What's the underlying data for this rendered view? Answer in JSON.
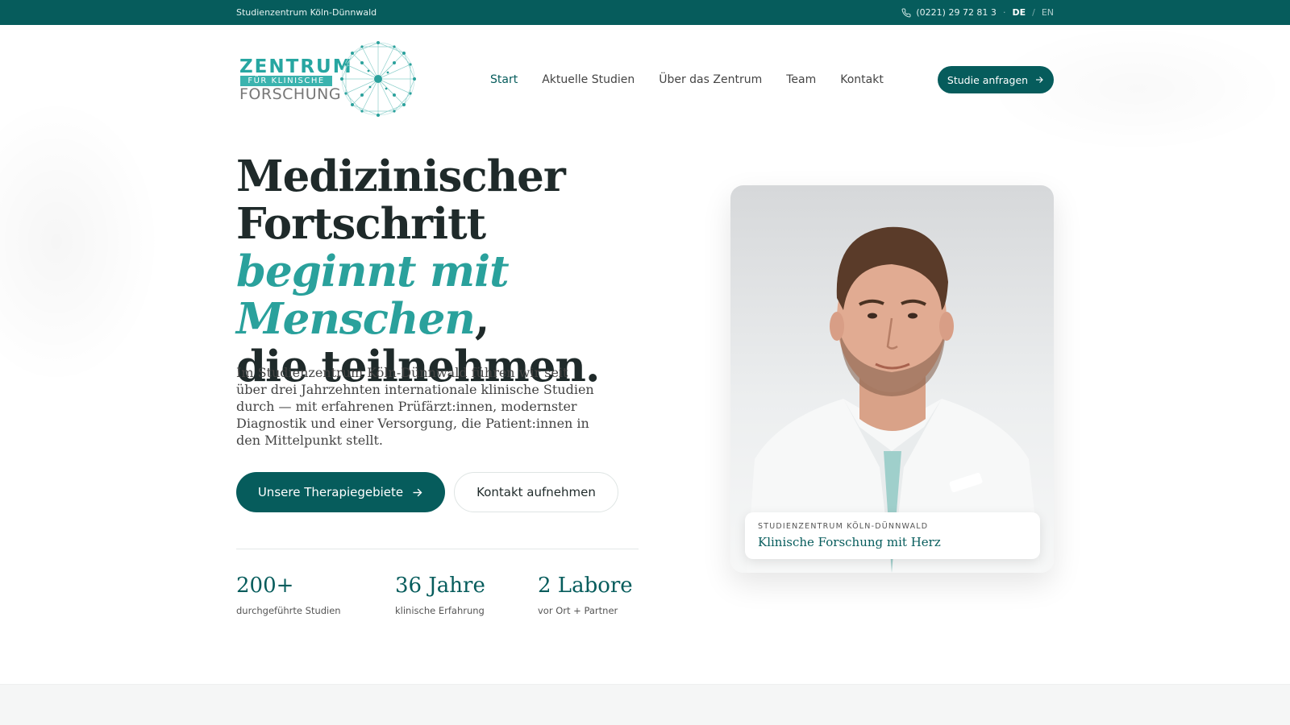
{
  "topbar": {
    "site_name": "Studienzentrum Köln-Dünnwald",
    "phone": "(0221) 29 72 81 3",
    "separator": "·",
    "lang_active": "DE",
    "lang_sep": "/",
    "lang_other": "EN"
  },
  "logo": {
    "line1": "ZENTRUM",
    "line2": "FÜR KLINISCHE",
    "line3": "FORSCHUNG"
  },
  "nav": {
    "items": [
      {
        "label": "Start",
        "active": true
      },
      {
        "label": "Aktuelle Studien"
      },
      {
        "label": "Über das Zentrum"
      },
      {
        "label": "Team"
      },
      {
        "label": "Kontakt"
      }
    ],
    "cta_label": "Studie anfragen",
    "cta_icon": "arrow-right-icon"
  },
  "hero": {
    "headline_part1": "Medizinischer Fortschritt ",
    "headline_accent": "beginnt mit Menschen",
    "headline_part2": ",",
    "headline_part3": "die teilnehmen.",
    "lede": "Im Studienzentrum Köln-Dünnwald führen wir seit über drei Jahrzehnten internationale klinische Studien durch — mit erfahrenen Prüfärzt:innen, modernster Diagnostik und einer Versorgung, die Patient:innen in den Mittelpunkt stellt.",
    "primary_button": "Unsere Therapiegebiete",
    "secondary_button": "Kontakt aufnehmen",
    "stats": [
      {
        "value": "200+",
        "label": "durchgeführte Studien"
      },
      {
        "value": "36 Jahre",
        "label": "klinische Erfahrung"
      },
      {
        "value": "2 Labore",
        "label": "vor Ort + Partner"
      }
    ]
  },
  "photo_card": {
    "kicker": "STUDIENZENTRUM KÖLN-DÜNNWALD",
    "title": "Klinische Forschung mit Herz"
  },
  "colors": {
    "primary": "#065c5c",
    "accent": "#2aa19c"
  }
}
